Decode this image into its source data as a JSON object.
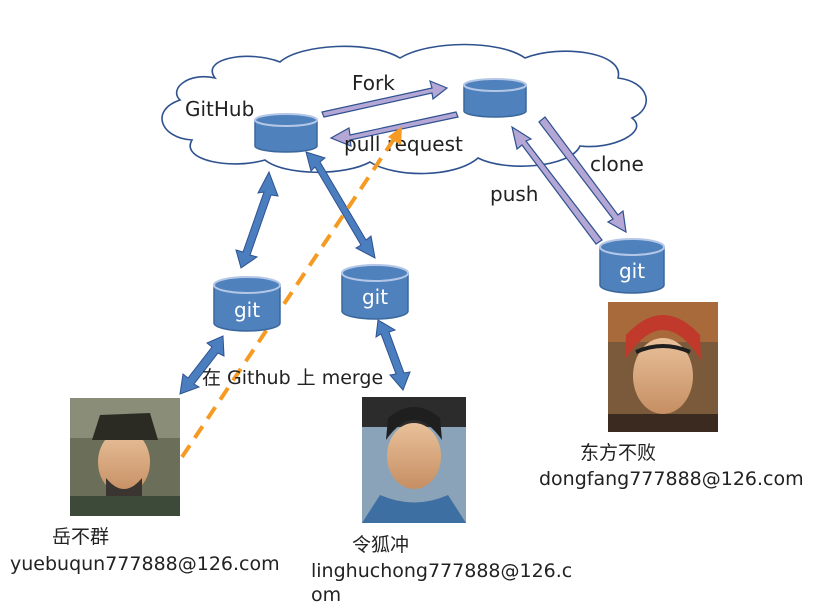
{
  "labels": {
    "github": "GitHub",
    "fork": "Fork",
    "pull_request": "pull request",
    "clone": "clone",
    "push": "push",
    "merge": "在 Github 上 merge",
    "git": "git"
  },
  "people": [
    {
      "name": "岳不群",
      "email": "yuebuqun777888@126.com"
    },
    {
      "name": "令狐冲",
      "email_line1": "linghuchong777888@126.c",
      "email_line2": "om"
    },
    {
      "name": "东方不败",
      "email": "dongfang777888@126.com"
    }
  ],
  "colors": {
    "cylinder_fill": "#4f81bd",
    "cylinder_stroke": "#3a679c",
    "cylinder_top": "#b4c7e7",
    "cloud_stroke": "#2f528f",
    "blue_arrow": "#4a7ebf",
    "purple_arrow": "#b4a7d6",
    "dashed_arrow": "#f59a23"
  },
  "icons": {
    "repo": "database-cylinder-icon",
    "person_photo": "portrait-photo"
  }
}
